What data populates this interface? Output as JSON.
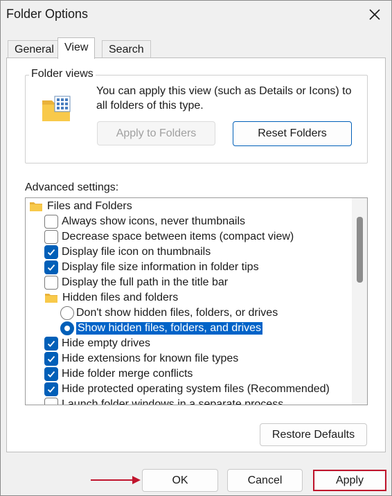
{
  "window": {
    "title": "Folder Options"
  },
  "tabs": [
    {
      "label": "General"
    },
    {
      "label": "View"
    },
    {
      "label": "Search"
    }
  ],
  "folder_views": {
    "legend": "Folder views",
    "description": "You can apply this view (such as Details or Icons) to all folders of this type.",
    "apply_button": "Apply to Folders",
    "reset_button": "Reset Folders"
  },
  "advanced": {
    "label": "Advanced settings:",
    "items": [
      {
        "type": "folder",
        "label": "Files and Folders"
      },
      {
        "type": "checkbox",
        "checked": false,
        "label": "Always show icons, never thumbnails"
      },
      {
        "type": "checkbox",
        "checked": false,
        "label": "Decrease space between items (compact view)"
      },
      {
        "type": "checkbox",
        "checked": true,
        "label": "Display file icon on thumbnails"
      },
      {
        "type": "checkbox",
        "checked": true,
        "label": "Display file size information in folder tips"
      },
      {
        "type": "checkbox",
        "checked": false,
        "label": "Display the full path in the title bar"
      },
      {
        "type": "folder",
        "label": "Hidden files and folders"
      },
      {
        "type": "radio",
        "selected": false,
        "label": "Don't show hidden files, folders, or drives"
      },
      {
        "type": "radio",
        "selected": true,
        "label": "Show hidden files, folders, and drives"
      },
      {
        "type": "checkbox",
        "checked": true,
        "label": "Hide empty drives"
      },
      {
        "type": "checkbox",
        "checked": true,
        "label": "Hide extensions for known file types"
      },
      {
        "type": "checkbox",
        "checked": true,
        "label": "Hide folder merge conflicts"
      },
      {
        "type": "checkbox",
        "checked": true,
        "label": "Hide protected operating system files (Recommended)"
      },
      {
        "type": "checkbox",
        "checked": false,
        "label": "Launch folder windows in a separate process"
      }
    ]
  },
  "restore_button": "Restore Defaults",
  "footer": {
    "ok": "OK",
    "cancel": "Cancel",
    "apply": "Apply"
  },
  "colors": {
    "accent": "#005fb8",
    "selection": "#0063c8",
    "annotation": "#c0142c",
    "folder": "#f8c94a"
  }
}
